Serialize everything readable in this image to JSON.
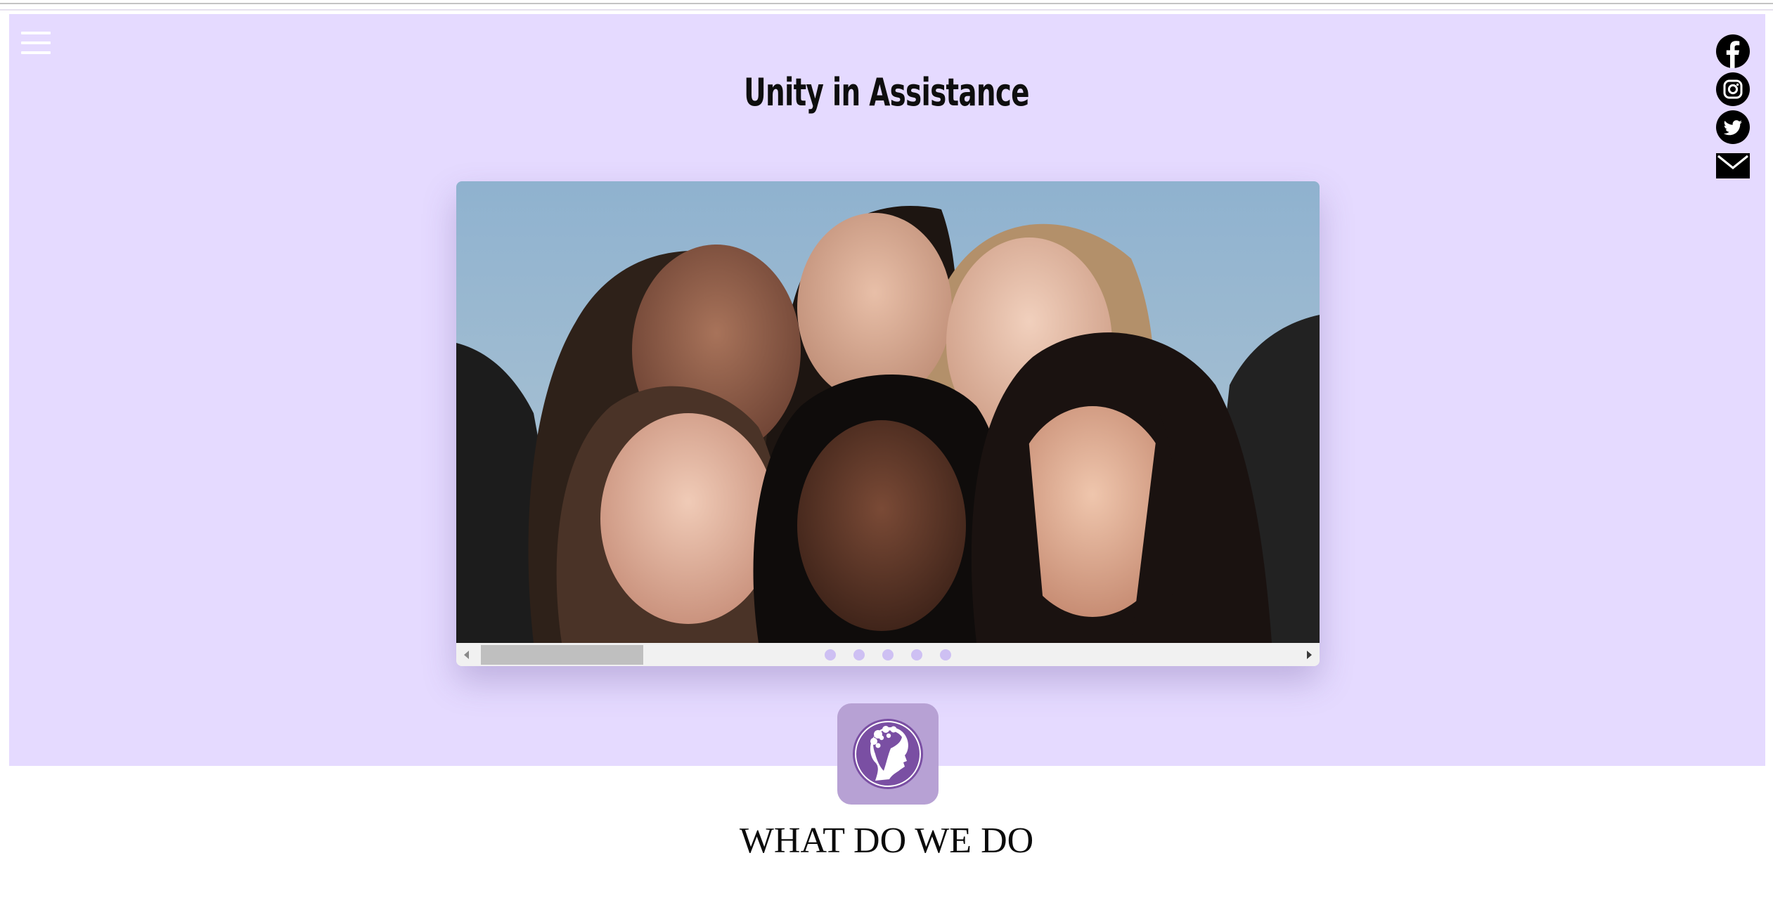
{
  "site": {
    "title": "Unity in Assistance"
  },
  "social_links": [
    {
      "name": "facebook-icon"
    },
    {
      "name": "instagram-icon"
    },
    {
      "name": "twitter-icon"
    },
    {
      "name": "email-icon"
    }
  ],
  "carousel": {
    "slide_count": 5,
    "active_index": 0
  },
  "section": {
    "heading": "WHAT DO WE DO"
  },
  "colors": {
    "hero_background": "#e5daff",
    "logo_tile": "#b7a1d4",
    "logo_disc": "#7a4fa3",
    "dot": "#cec0f3"
  }
}
